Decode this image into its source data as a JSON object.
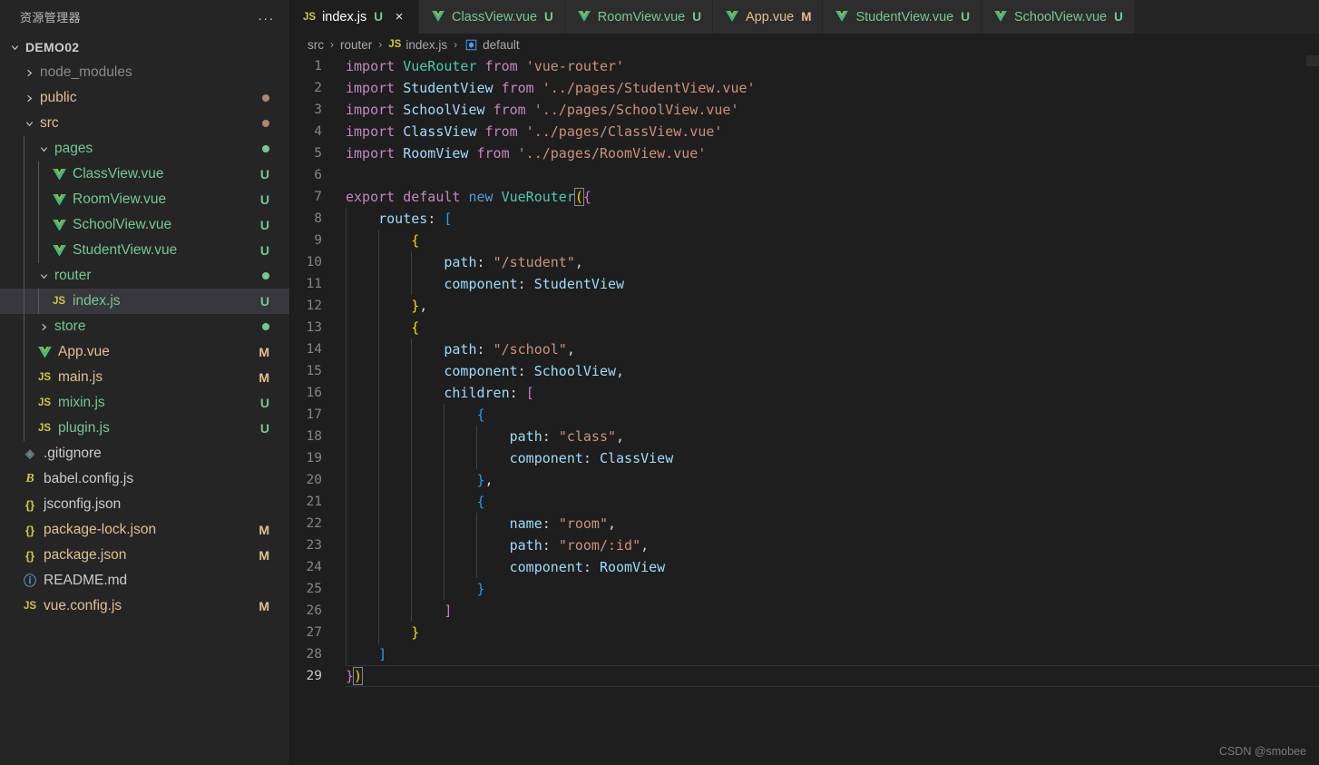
{
  "sidebar": {
    "title": "资源管理器",
    "more_actions": "...",
    "root": {
      "label": "DEMO02",
      "expanded": true
    },
    "items": [
      {
        "label": "node_modules",
        "type": "folder",
        "icon": "chevron-right-icon",
        "expanded": false,
        "indent": 1,
        "badge": "",
        "dot": "",
        "color": "#8a8a8a"
      },
      {
        "label": "public",
        "type": "folder",
        "icon": "chevron-right-icon",
        "expanded": false,
        "indent": 1,
        "badge": "",
        "dot": "#a9886c",
        "color": "#e2c08d"
      },
      {
        "label": "src",
        "type": "folder",
        "icon": "chevron-down-icon",
        "expanded": true,
        "indent": 1,
        "badge": "",
        "dot": "#a9886c",
        "color": "#e2c08d"
      },
      {
        "label": "pages",
        "type": "folder",
        "icon": "chevron-down-icon",
        "expanded": true,
        "indent": 2,
        "badge": "",
        "dot": "#73c991",
        "color": "#73c991"
      },
      {
        "label": "ClassView.vue",
        "type": "vue",
        "icon": "vue-icon",
        "indent": 3,
        "badge": "U",
        "dot": "",
        "color": "#73c991"
      },
      {
        "label": "RoomView.vue",
        "type": "vue",
        "icon": "vue-icon",
        "indent": 3,
        "badge": "U",
        "dot": "",
        "color": "#73c991"
      },
      {
        "label": "SchoolView.vue",
        "type": "vue",
        "icon": "vue-icon",
        "indent": 3,
        "badge": "U",
        "dot": "",
        "color": "#73c991"
      },
      {
        "label": "StudentView.vue",
        "type": "vue",
        "icon": "vue-icon",
        "indent": 3,
        "badge": "U",
        "dot": "",
        "color": "#73c991"
      },
      {
        "label": "router",
        "type": "folder",
        "icon": "chevron-down-icon",
        "expanded": true,
        "indent": 2,
        "badge": "",
        "dot": "#73c991",
        "color": "#73c991"
      },
      {
        "label": "index.js",
        "type": "js",
        "icon": "js-icon",
        "indent": 3,
        "badge": "U",
        "dot": "",
        "color": "#73c991",
        "selected": true
      },
      {
        "label": "store",
        "type": "folder",
        "icon": "chevron-right-icon",
        "expanded": false,
        "indent": 2,
        "badge": "",
        "dot": "#73c991",
        "color": "#73c991"
      },
      {
        "label": "App.vue",
        "type": "vue",
        "icon": "vue-icon",
        "indent": 2,
        "badge": "M",
        "dot": "",
        "color": "#e2c08d"
      },
      {
        "label": "main.js",
        "type": "js",
        "icon": "js-icon",
        "indent": 2,
        "badge": "M",
        "dot": "",
        "color": "#e2c08d"
      },
      {
        "label": "mixin.js",
        "type": "js",
        "icon": "js-icon",
        "indent": 2,
        "badge": "U",
        "dot": "",
        "color": "#73c991"
      },
      {
        "label": "plugin.js",
        "type": "js",
        "icon": "js-icon",
        "indent": 2,
        "badge": "U",
        "dot": "",
        "color": "#73c991"
      },
      {
        "label": ".gitignore",
        "type": "git",
        "icon": "gitignore-icon",
        "indent": 1,
        "badge": "",
        "dot": "",
        "color": "#cccccc"
      },
      {
        "label": "babel.config.js",
        "type": "babel",
        "icon": "babel-icon",
        "indent": 1,
        "badge": "",
        "dot": "",
        "color": "#cccccc"
      },
      {
        "label": "jsconfig.json",
        "type": "json",
        "icon": "json-icon",
        "indent": 1,
        "badge": "",
        "dot": "",
        "color": "#cccccc"
      },
      {
        "label": "package-lock.json",
        "type": "json",
        "icon": "json-icon",
        "indent": 1,
        "badge": "M",
        "dot": "",
        "color": "#e2c08d"
      },
      {
        "label": "package.json",
        "type": "json",
        "icon": "json-icon",
        "indent": 1,
        "badge": "M",
        "dot": "",
        "color": "#e2c08d"
      },
      {
        "label": "README.md",
        "type": "md",
        "icon": "markdown-info-icon",
        "indent": 1,
        "badge": "",
        "dot": "",
        "color": "#cccccc"
      },
      {
        "label": "vue.config.js",
        "type": "js",
        "icon": "js-icon",
        "indent": 1,
        "badge": "M",
        "dot": "",
        "color": "#e2c08d"
      }
    ]
  },
  "tabs": [
    {
      "label": "index.js",
      "icon": "js-icon",
      "badge": "U",
      "badge_color": "#73c991",
      "color": "#ffffff",
      "active": true,
      "close": "×"
    },
    {
      "label": "ClassView.vue",
      "icon": "vue-icon",
      "badge": "U",
      "badge_color": "#73c991",
      "color": "#73c991",
      "active": false
    },
    {
      "label": "RoomView.vue",
      "icon": "vue-icon",
      "badge": "U",
      "badge_color": "#73c991",
      "color": "#73c991",
      "active": false
    },
    {
      "label": "App.vue",
      "icon": "vue-icon",
      "badge": "M",
      "badge_color": "#e2c08d",
      "color": "#e2c08d",
      "active": false
    },
    {
      "label": "StudentView.vue",
      "icon": "vue-icon",
      "badge": "U",
      "badge_color": "#73c991",
      "color": "#73c991",
      "active": false
    },
    {
      "label": "SchoolView.vue",
      "icon": "vue-icon",
      "badge": "U",
      "badge_color": "#73c991",
      "color": "#73c991",
      "active": false
    }
  ],
  "breadcrumb": {
    "separator": "›",
    "items": [
      {
        "label": "src",
        "icon": ""
      },
      {
        "label": "router",
        "icon": ""
      },
      {
        "label": "index.js",
        "icon": "js-icon"
      },
      {
        "label": "default",
        "icon": "symbol-object-icon"
      }
    ]
  },
  "editor": {
    "language": "javascript",
    "file": "index.js",
    "cursor_line": 29,
    "total_lines": 29,
    "lines": [
      {
        "n": 1,
        "text": "import VueRouter from 'vue-router'"
      },
      {
        "n": 2,
        "text": "import StudentView from '../pages/StudentView.vue'"
      },
      {
        "n": 3,
        "text": "import SchoolView from '../pages/SchoolView.vue'"
      },
      {
        "n": 4,
        "text": "import ClassView from '../pages/ClassView.vue'"
      },
      {
        "n": 5,
        "text": "import RoomView from '../pages/RoomView.vue'"
      },
      {
        "n": 6,
        "text": ""
      },
      {
        "n": 7,
        "text": "export default new VueRouter({"
      },
      {
        "n": 8,
        "text": "    routes: ["
      },
      {
        "n": 9,
        "text": "        {"
      },
      {
        "n": 10,
        "text": "            path: \"/student\","
      },
      {
        "n": 11,
        "text": "            component: StudentView"
      },
      {
        "n": 12,
        "text": "        },"
      },
      {
        "n": 13,
        "text": "        {"
      },
      {
        "n": 14,
        "text": "            path: \"/school\","
      },
      {
        "n": 15,
        "text": "            component: SchoolView,"
      },
      {
        "n": 16,
        "text": "            children: ["
      },
      {
        "n": 17,
        "text": "                {"
      },
      {
        "n": 18,
        "text": "                    path: \"class\","
      },
      {
        "n": 19,
        "text": "                    component: ClassView"
      },
      {
        "n": 20,
        "text": "                },"
      },
      {
        "n": 21,
        "text": "                {"
      },
      {
        "n": 22,
        "text": "                    name: \"room\","
      },
      {
        "n": 23,
        "text": "                    path: \"room/:id\","
      },
      {
        "n": 24,
        "text": "                    component: RoomView"
      },
      {
        "n": 25,
        "text": "                }"
      },
      {
        "n": 26,
        "text": "            ]"
      },
      {
        "n": 27,
        "text": "        }"
      },
      {
        "n": 28,
        "text": "    ]"
      },
      {
        "n": 29,
        "text": "})"
      }
    ]
  },
  "watermark": "CSDN @smobee",
  "colors": {
    "sidebar_bg": "#252526",
    "editor_bg": "#1e1e1e",
    "tabbar_bg": "#252526",
    "tab_inactive_bg": "#2d2d2d",
    "selection_bg": "#37373d",
    "keyword": "#c586c0",
    "keyword_blue": "#569cd6",
    "identifier": "#9cdcfe",
    "string": "#ce9178",
    "function": "#4ec9b0",
    "bracket1": "#ffd700",
    "bracket2": "#da70d6",
    "bracket3": "#179fff",
    "untracked": "#73c991",
    "modified": "#e2c08d"
  }
}
